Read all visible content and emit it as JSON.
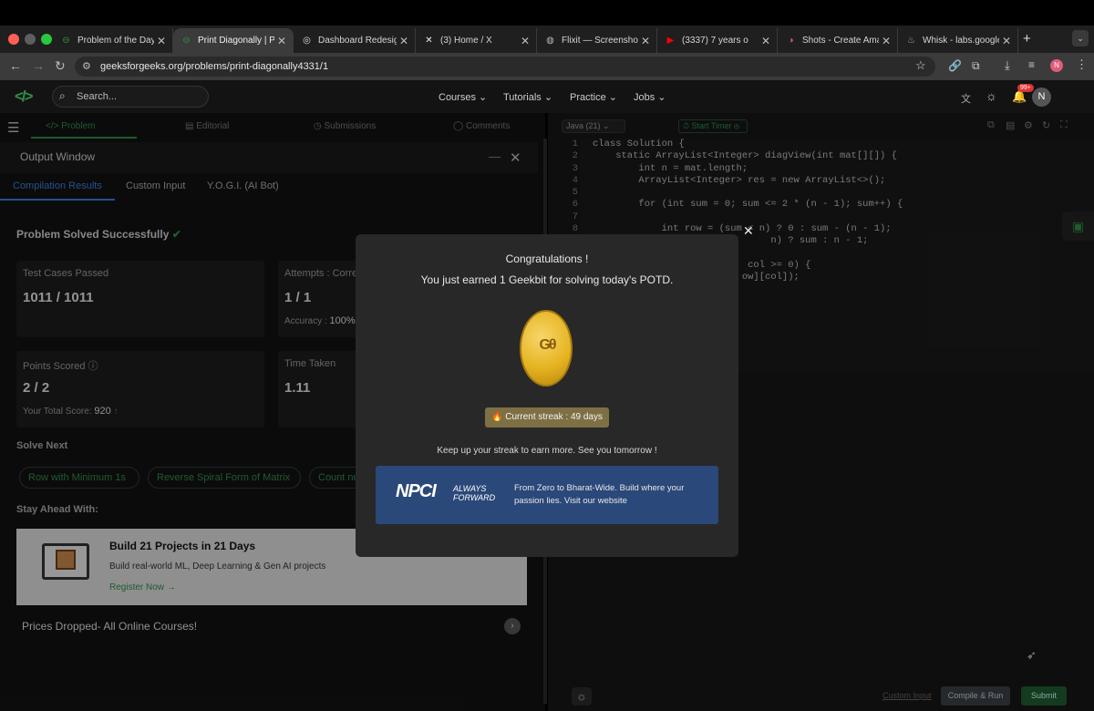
{
  "browser": {
    "tabs": [
      {
        "title": "Problem of the Day |",
        "icon": "gfg-icon"
      },
      {
        "title": "Print Diagonally | Pra",
        "icon": "gfg-icon",
        "active": true
      },
      {
        "title": "Dashboard Redesign",
        "icon": "openai-icon"
      },
      {
        "title": "(3) Home / X",
        "icon": "x-icon"
      },
      {
        "title": "Flixit — Screenshot E",
        "icon": "globe-icon"
      },
      {
        "title": "(3337) 7 years o",
        "icon": "youtube-icon"
      },
      {
        "title": "Shots - Create Amaz",
        "icon": "shots-icon"
      },
      {
        "title": "Whisk - labs.google/",
        "icon": "whisk-icon"
      }
    ],
    "url": "geeksforgeeks.org/problems/print-diagonally4331/1"
  },
  "site": {
    "search_placeholder": "Search...",
    "nav": [
      "Courses",
      "Tutorials",
      "Practice",
      "Jobs"
    ],
    "notif_badge": "99+",
    "avatar_letter": "N"
  },
  "left": {
    "tabs": [
      "Problem",
      "Editorial",
      "Submissions",
      "Comments"
    ],
    "output_title": "Output Window",
    "output_tabs": [
      "Compilation Results",
      "Custom Input",
      "Y.O.G.I. (AI Bot)"
    ],
    "solved_text": "Problem Solved Successfully",
    "test_cases_label": "Test Cases Passed",
    "test_cases_value": "1011 / 1011",
    "attempts_label": "Attempts : Correc",
    "attempts_value": "1 / 1",
    "accuracy_label": "Accuracy :",
    "accuracy_value": "100%",
    "points_label": "Points Scored",
    "points_value": "2 / 2",
    "total_score_label": "Your Total Score:",
    "total_score_value": "920",
    "time_label": "Time Taken",
    "time_value": "1.11",
    "solve_next_title": "Solve Next",
    "solve_next": [
      "Row with Minimum 1s",
      "Reverse Spiral Form of Matrix",
      "Count nu"
    ],
    "stay_ahead_title": "Stay Ahead With:",
    "promo_title": "Build 21 Projects in 21 Days",
    "promo_desc": "Build real-world ML, Deep Learning & Gen AI projects",
    "promo_cta": "Register Now",
    "prices_text": "Prices Dropped- All Online Courses!"
  },
  "editor": {
    "language": "Java (21)",
    "timer": "Start Timer",
    "lines": [
      "class Solution {",
      "    static ArrayList<Integer> diagView(int mat[][]) {",
      "        int n = mat.length;",
      "        ArrayList<Integer> res = new ArrayList<>();",
      "",
      "        for (int sum = 0; sum <= 2 * (n - 1); sum++) {",
      "",
      "            int row = (sum < n) ? 0 : sum - (n - 1);",
      "                               n) ? sum : n - 1;",
      "",
      "                           col >= 0) {",
      "                          ow][col]);"
    ],
    "custom_input": "Custom Input",
    "compile_btn": "Compile & Run",
    "submit_btn": "Submit"
  },
  "modal": {
    "title": "Congratulations !",
    "subtitle": "You just earned 1 Geekbit for solving today's POTD.",
    "streak": "Current streak : 49 days",
    "footer": "Keep up your streak to earn more. See you tomorrow !",
    "ad_brand": "NPCI",
    "ad_tagline": "ALWAYS FORWARD",
    "ad_text": "From Zero to Bharat-Wide. Build where your passion lies. Visit our website"
  },
  "colors": {
    "brand": "#2f8d46",
    "accent_blue": "#3b7dd8",
    "coin": "#e6b422"
  }
}
